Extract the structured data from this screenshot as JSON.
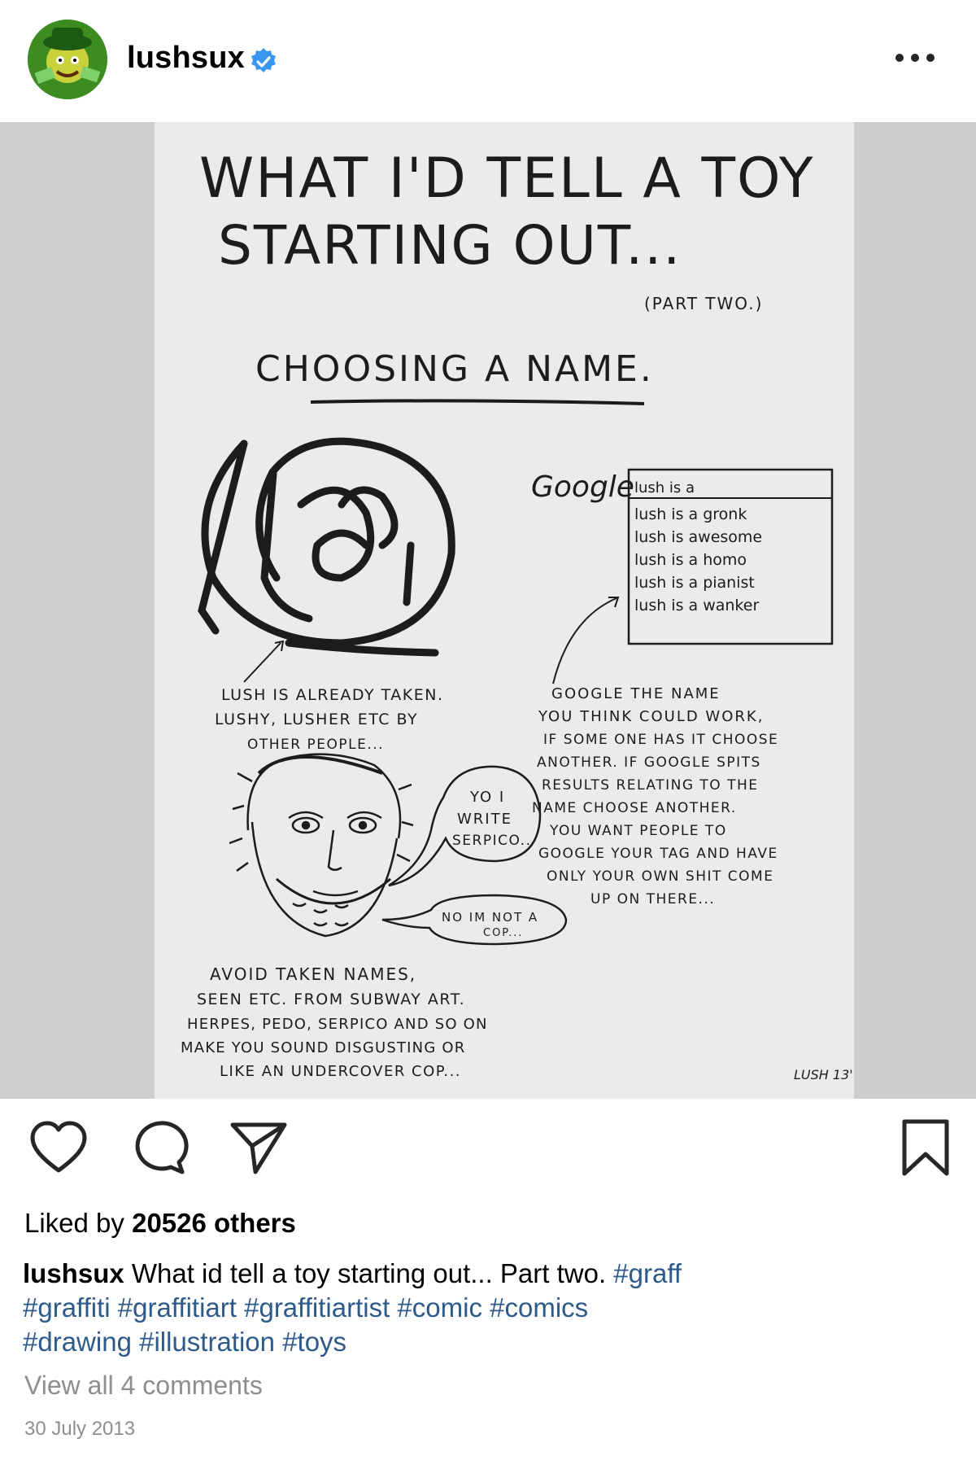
{
  "header": {
    "username": "lushsux",
    "verified_icon": "verified-badge-icon",
    "more_icon": "more-options-icon"
  },
  "photo": {
    "title_line1": "WHAT I'D TELL A TOY",
    "title_line2": "STARTING OUT...",
    "part": "(PART TWO.)",
    "heading": "CHOOSING A NAME.",
    "tag_text": "LUSH",
    "google_logo": "Google",
    "search_box": "lush is a",
    "suggestions": [
      "lush is a gronk",
      "lush is awesome",
      "lush is a homo",
      "lush is a pianist",
      "lush is a wanker"
    ],
    "left_note": [
      "LUSH IS ALREADY TAKEN.",
      "LUSHY, LUSHER ETC BY",
      "OTHER PEOPLE..."
    ],
    "right_note": [
      "GOOGLE THE NAME",
      "YOU THINK COULD WORK,",
      "IF SOME ONE HAS IT CHOOSE",
      "ANOTHER. IF GOOGLE SPITS",
      "RESULTS RELATING TO THE",
      "NAME CHOOSE ANOTHER.",
      "YOU WANT PEOPLE TO",
      "GOOGLE YOUR TAG AND HAVE",
      "ONLY YOUR OWN SHIT COME",
      "UP ON THERE..."
    ],
    "bubble1": [
      "YO I",
      "WRITE",
      "SERPICO.."
    ],
    "bubble2": [
      "NO IM NOT A",
      "COP..."
    ],
    "bottom_note": [
      "AVOID TAKEN NAMES,",
      "SEEN ETC. FROM SUBWAY ART.",
      "HERPES, PEDO, SERPICO AND SO ON",
      "MAKE YOU SOUND DISGUSTING OR",
      "LIKE AN UNDERCOVER COP..."
    ],
    "signature": "LUSH 13'"
  },
  "actions": {
    "like_icon": "heart-icon",
    "comment_icon": "comment-icon",
    "share_icon": "paper-plane-icon",
    "save_icon": "bookmark-icon"
  },
  "likes": {
    "prefix": "Liked by ",
    "count_text": "20526 others"
  },
  "caption": {
    "username": "lushsux",
    "text": " What id tell a toy starting out... Part two. ",
    "hashtags": [
      "#graff",
      "#graffiti",
      "#graffitiart",
      "#graffitiartist",
      "#comic",
      "#comics",
      "#drawing",
      "#illustration",
      "#toys"
    ]
  },
  "comments": {
    "view_all": "View all 4 comments"
  },
  "date": "30 July 2013",
  "colors": {
    "hashtag": "#2e5a8a",
    "verified": "#3897f0",
    "muted": "#8e8e8e"
  }
}
